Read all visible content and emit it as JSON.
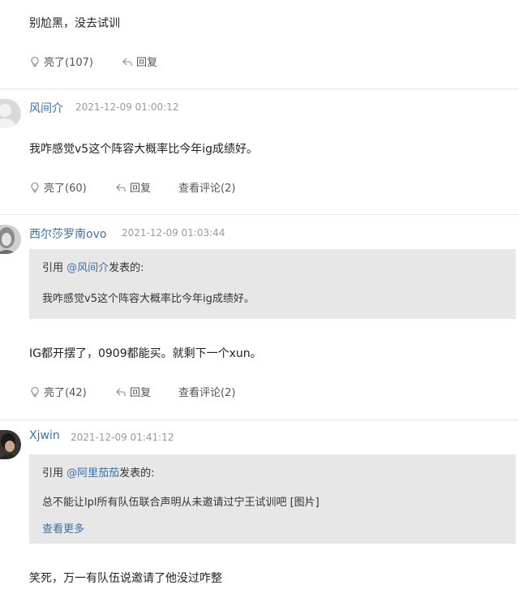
{
  "comments": [
    {
      "text": "别尬黑，没去试训",
      "like_label": "亮了(107)",
      "reply_label": "回复"
    },
    {
      "username": "风间介",
      "time": "2021-12-09 01:00:12",
      "text": "我咋感觉v5这个阵容大概率比今年ig成绩好。",
      "like_label": "亮了(60)",
      "reply_label": "回复",
      "view_comments_label": "查看评论(2)"
    },
    {
      "username": "西尔莎罗南ovo",
      "time": "2021-12-09 01:03:44",
      "quote": {
        "prefix": "引用 ",
        "user": "@风间介",
        "suffix": "发表的:",
        "text": "我咋感觉v5这个阵容大概率比今年ig成绩好。"
      },
      "text": "IG都开摆了，0909都能买。就剩下一个xun。",
      "like_label": "亮了(42)",
      "reply_label": "回复",
      "view_comments_label": "查看评论(2)"
    },
    {
      "username": "Xjwin",
      "time": "2021-12-09 01:41:12",
      "quote": {
        "prefix": "引用 ",
        "user": "@阿里茄茄",
        "suffix": "发表的:",
        "text": "总不能让lpl所有队伍联合声明从未邀请过宁王试训吧 [图片]",
        "more_label": "查看更多"
      },
      "text": "笑死，万一有队伍说邀请了他没过咋整"
    }
  ],
  "colors": {
    "link": "#3d6fa8",
    "time": "#9a9a9a",
    "quote_bg": "#e7e7e7",
    "divider": "#e6e6e6"
  },
  "icons": {
    "like": "lightbulb-icon",
    "reply": "reply-arrow-icon"
  }
}
